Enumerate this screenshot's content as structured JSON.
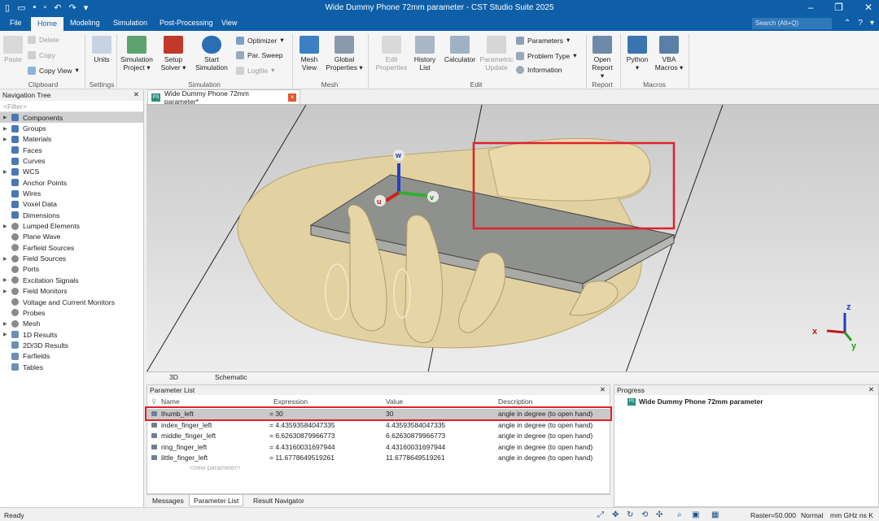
{
  "window": {
    "title": "Wide Dummy Phone 72mm parameter - CST Studio Suite 2025"
  },
  "menu": {
    "tabs": [
      "File",
      "Home",
      "Modeling",
      "Simulation",
      "Post-Processing",
      "View"
    ],
    "search_placeholder": "Search (Alt+Q)"
  },
  "ribbon": {
    "paste": "Paste",
    "delete": "Delete",
    "copy": "Copy",
    "copy_view": "Copy View",
    "units": "Units",
    "sim_project_1": "Simulation",
    "sim_project_2": "Project",
    "setup_solver_1": "Setup",
    "setup_solver_2": "Solver",
    "start_sim_1": "Start",
    "start_sim_2": "Simulation",
    "optimizer": "Optimizer",
    "par_sweep": "Par. Sweep",
    "logfile": "Logfile",
    "mesh_view_1": "Mesh",
    "mesh_view_2": "View",
    "global_props_1": "Global",
    "global_props_2": "Properties",
    "edit_props_1": "Edit",
    "edit_props_2": "Properties",
    "history_1": "History",
    "history_2": "List",
    "calculator": "Calculator",
    "param_update_1": "Parametric",
    "param_update_2": "Update",
    "parameters": "Parameters",
    "problem_type": "Problem Type",
    "information": "Information",
    "open_report_1": "Open",
    "open_report_2": "Report",
    "python": "Python",
    "vba_1": "VBA",
    "vba_2": "Macros",
    "groups": [
      "Clipboard",
      "Settings",
      "Simulation",
      "Mesh",
      "Edit",
      "Report",
      "Macros"
    ]
  },
  "nav": {
    "title": "Navigation Tree",
    "filter": "<Filter>",
    "items": [
      {
        "label": "Components",
        "icon": "cube-icon"
      },
      {
        "label": "Groups",
        "icon": "cube-icon"
      },
      {
        "label": "Materials",
        "icon": "cube-icon"
      },
      {
        "label": "Faces",
        "icon": "cube-icon"
      },
      {
        "label": "Curves",
        "icon": "cube-icon"
      },
      {
        "label": "WCS",
        "icon": "cube-icon"
      },
      {
        "label": "Anchor Points",
        "icon": "cube-icon"
      },
      {
        "label": "Wires",
        "icon": "cube-icon"
      },
      {
        "label": "Voxel Data",
        "icon": "cube-icon"
      },
      {
        "label": "Dimensions",
        "icon": "cube-icon"
      },
      {
        "label": "Lumped Elements",
        "icon": "gear-icon"
      },
      {
        "label": "Plane Wave",
        "icon": "gear-icon"
      },
      {
        "label": "Farfield Sources",
        "icon": "gear-icon"
      },
      {
        "label": "Field Sources",
        "icon": "gear-icon"
      },
      {
        "label": "Ports",
        "icon": "gear-icon"
      },
      {
        "label": "Excitation Signals",
        "icon": "gear-icon"
      },
      {
        "label": "Field Monitors",
        "icon": "gear-icon"
      },
      {
        "label": "Voltage and Current Monitors",
        "icon": "gear-icon"
      },
      {
        "label": "Probes",
        "icon": "gear-icon"
      },
      {
        "label": "Mesh",
        "icon": "gear-icon"
      },
      {
        "label": "1D Results",
        "icon": "chart-icon"
      },
      {
        "label": "2D/3D Results",
        "icon": "chart-icon"
      },
      {
        "label": "Farfields",
        "icon": "chart-icon"
      },
      {
        "label": "Tables",
        "icon": "chart-icon"
      }
    ]
  },
  "document": {
    "tab_label": "Wide Dummy Phone 72mm parameter*",
    "ps_badge": "PS"
  },
  "viewport": {
    "axis_w": "w",
    "axis_u": "u",
    "axis_v": "v",
    "axis_x": "x",
    "axis_y": "y",
    "axis_z": "z"
  },
  "view_tabs": [
    "3D",
    "Schematic"
  ],
  "param_list": {
    "title": "Parameter List",
    "columns": [
      "Name",
      "Expression",
      "Value",
      "Description"
    ],
    "rows": [
      {
        "name": "thumb_left",
        "expression": "= 30",
        "value": "30",
        "description": "angle in degree (to open hand)"
      },
      {
        "name": "index_finger_left",
        "expression": "= 4.43593584047335",
        "value": "4.43593584047335",
        "description": "angle in degree (to open hand)"
      },
      {
        "name": "middle_finger_left",
        "expression": "= 6.62630879966773",
        "value": "6.62630879966773",
        "description": "angle in degree (to open hand)"
      },
      {
        "name": "ring_finger_left",
        "expression": "= 4.43160031697944",
        "value": "4.43160031697944",
        "description": "angle in degree (to open hand)"
      },
      {
        "name": "little_finger_left",
        "expression": "= 11.6778649519261",
        "value": "11.6778649519261",
        "description": "angle in degree (to open hand)"
      }
    ],
    "new_param": "<new parameter>"
  },
  "bottom_tabs": [
    "Messages",
    "Parameter List",
    "Result Navigator"
  ],
  "progress": {
    "title": "Progress",
    "item": "Wide Dummy Phone 72mm parameter"
  },
  "status": {
    "ready": "Ready",
    "raster": "Raster=50.000",
    "mode": "Normal",
    "units": "mm  GHz  ns  K"
  },
  "colors": {
    "brand": "#0e5fa8",
    "highlight": "#e0202a",
    "hand": "#e4d3a4",
    "phone": "#9a9a98"
  }
}
